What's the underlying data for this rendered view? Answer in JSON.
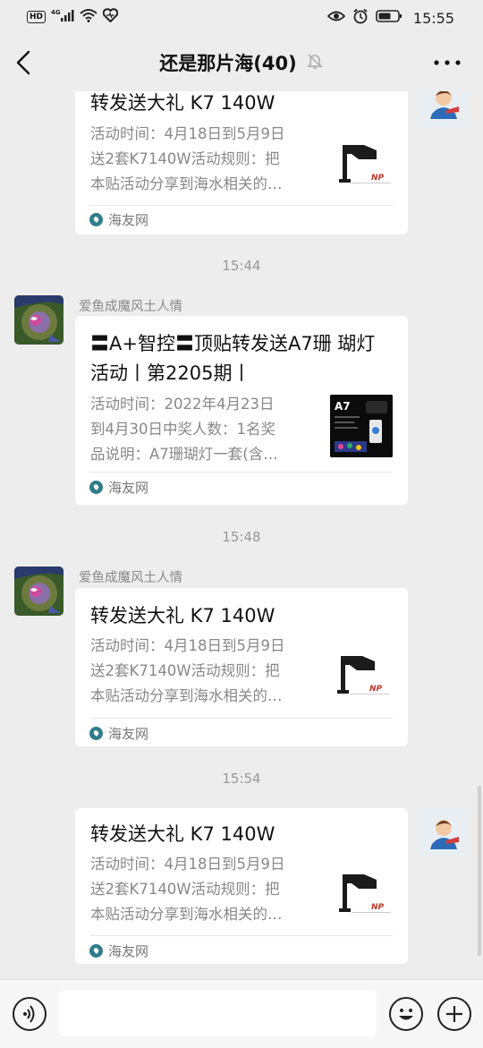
{
  "statusbar": {
    "left_badge": "HD",
    "network": "4G",
    "time": "15:55"
  },
  "navbar": {
    "title": "还是那片海(40)",
    "icons": [
      "back-arrow-icon",
      "mute-bell-icon",
      "more-dots-icon"
    ]
  },
  "chat": {
    "messages": [
      {
        "type": "link-card",
        "side": "right",
        "title": "转发送大礼 K7 140W",
        "desc_lines": [
          "活动时间：4月18日到5月9日",
          "送2套K7140W活动规则：把",
          "本贴活动分享到海水相关的…"
        ],
        "source": "海友网",
        "thumb": "K7 light"
      },
      {
        "type": "time",
        "text": "15:44"
      },
      {
        "type": "link-card",
        "side": "left",
        "sender": "爱鱼成魔风土人情",
        "title_lines": [
          "〓A+智控〓顶贴转发送A7珊 瑚灯",
          "活动丨第2205期丨"
        ],
        "desc_lines": [
          "活动时间：2022年4月23日",
          "到4月30日中奖人数：1名奖",
          "品说明：A7珊瑚灯一套(含…"
        ],
        "source": "海友网",
        "thumb": "A7"
      },
      {
        "type": "time",
        "text": "15:48"
      },
      {
        "type": "link-card",
        "side": "left",
        "sender": "爱鱼成魔风土人情",
        "title": "转发送大礼 K7 140W",
        "desc_lines": [
          "活动时间：4月18日到5月9日",
          "送2套K7140W活动规则：把",
          "本贴活动分享到海水相关的…"
        ],
        "source": "海友网",
        "thumb": "K7 light"
      },
      {
        "type": "time",
        "text": "15:54"
      },
      {
        "type": "link-card",
        "side": "right",
        "title": "转发送大礼 K7 140W",
        "desc_lines": [
          "活动时间：4月18日到5月9日",
          "送2套K7140W活动规则：把",
          "本贴活动分享到海水相关的…"
        ],
        "source": "海友网",
        "thumb": "K7 light"
      }
    ]
  },
  "bottombar": {
    "icons": [
      "voice-icon",
      "emoji-icon",
      "plus-icon"
    ],
    "input_value": ""
  },
  "colors": {
    "background": "#ededed",
    "card": "#ffffff",
    "secondary_text": "#888888"
  }
}
